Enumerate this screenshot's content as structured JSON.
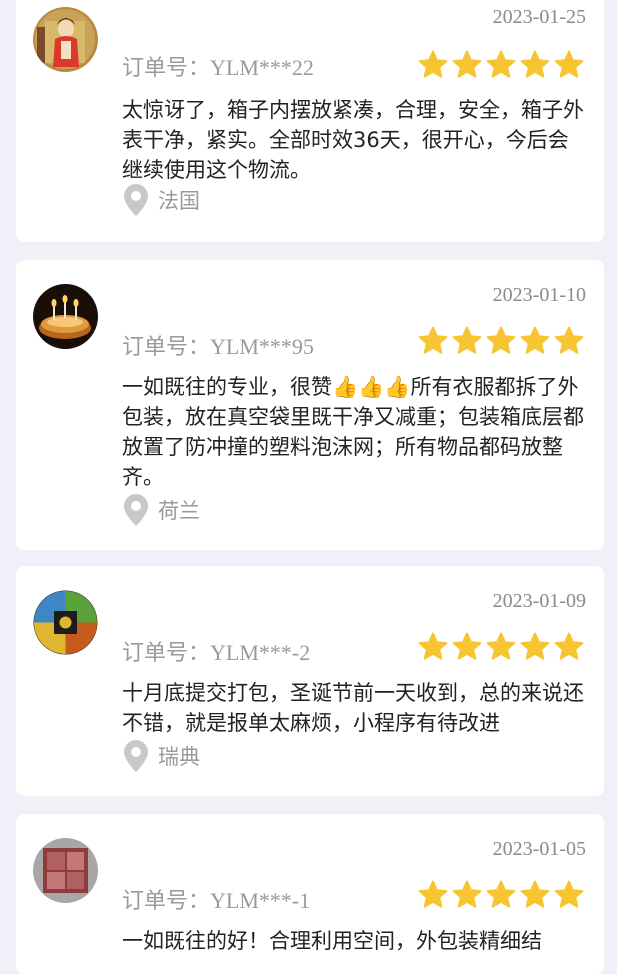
{
  "order_prefix": "订单号：",
  "colors": {
    "star": "#f7c531",
    "background": "#eff0f8",
    "card": "#ffffff",
    "pin": "#c8c8c8"
  },
  "reviews": [
    {
      "date": "2023-01-25",
      "order_id": "YLM***22",
      "rating": 5,
      "text": "太惊讶了，箱子内摆放紧凑，合理，安全，箱子外表干净，紧实。全部时效36天，很开心，今后会继续使用这个物流。",
      "location": "法国",
      "avatar_icon": "avatar-traditional-figure-icon"
    },
    {
      "date": "2023-01-10",
      "order_id": "YLM***95",
      "rating": 5,
      "text": "一如既往的专业，很赞👍👍👍所有衣服都拆了外包装，放在真空袋里既干净又减重；包装箱底层都放置了防冲撞的塑料泡沫网；所有物品都码放整齐。",
      "location": "荷兰",
      "avatar_icon": "avatar-birthday-cake-icon"
    },
    {
      "date": "2023-01-09",
      "order_id": "YLM***-2",
      "rating": 5,
      "text": "十月底提交打包，圣诞节前一天收到，总的来说还不错，就是报单太麻烦，小程序有待改进",
      "location": "瑞典",
      "avatar_icon": "avatar-four-elements-icon"
    },
    {
      "date": "2023-01-05",
      "order_id": "YLM***-1",
      "rating": 5,
      "text": "一如既往的好！合理利用空间，外包装精细结",
      "location": "",
      "avatar_icon": "avatar-seal-stamp-icon"
    }
  ]
}
